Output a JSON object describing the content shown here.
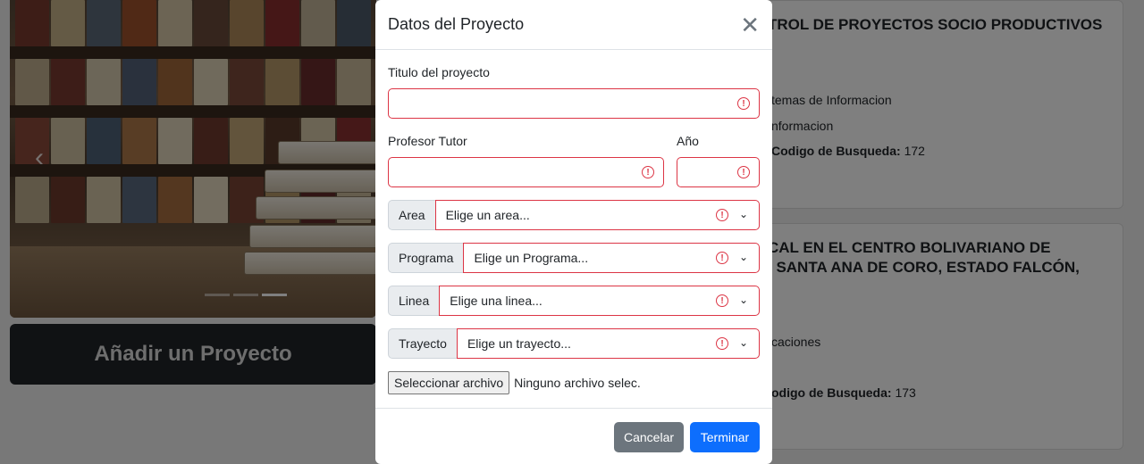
{
  "background": {
    "add_project_button": "Añadir un Proyecto",
    "card1": {
      "title": "TROL DE PROYECTOS SOCIO PRODUCTIVOS",
      "line1": "temas de Informacion",
      "line2": "nformacion",
      "code_label": "Codigo de Busqueda:",
      "code_value": "172"
    },
    "card2": {
      "title_line1": "CAL EN EL CENTRO BOLIVARIANO DE",
      "title_line2": ", SANTA ANA DE CORO, ESTADO FALCÓN,",
      "line1": "caciones",
      "code_label": "odigo de Busqueda:",
      "code_value": "173"
    }
  },
  "modal": {
    "title": "Datos del Proyecto",
    "close_glyph": "✕",
    "titulo_label": "Titulo del proyecto",
    "tutor_label": "Profesor Tutor",
    "anio_label": "Año",
    "selects": [
      {
        "label": "Area",
        "placeholder": "Elige un area..."
      },
      {
        "label": "Programa",
        "placeholder": "Elige un Programa..."
      },
      {
        "label": "Linea",
        "placeholder": "Elige una linea..."
      },
      {
        "label": "Trayecto",
        "placeholder": "Elige un trayecto..."
      }
    ],
    "file_button": "Seleccionar archivo",
    "file_status": "Ninguno archivo selec.",
    "cancel_button": "Cancelar",
    "submit_button": "Terminar"
  },
  "colors": {
    "invalid": "#dc3545",
    "primary": "#0d6efd",
    "secondary": "#6c757d"
  }
}
